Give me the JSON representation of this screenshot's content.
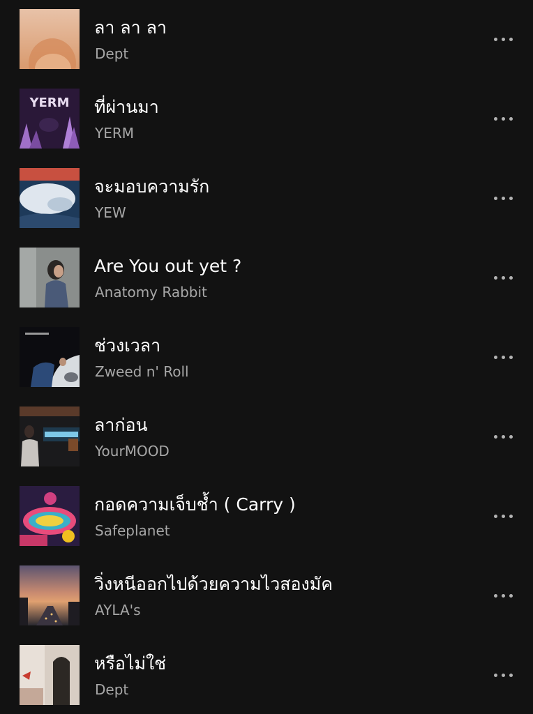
{
  "tracks": [
    {
      "title": "ลา ลา ลา",
      "artist": "Dept",
      "cover_icon": "album-cover"
    },
    {
      "title": "ที่ผ่านมา",
      "artist": "YERM",
      "cover_icon": "album-cover"
    },
    {
      "title": "จะมอบความรัก",
      "artist": "YEW",
      "cover_icon": "album-cover"
    },
    {
      "title": "Are You out yet ?",
      "artist": "Anatomy Rabbit",
      "cover_icon": "album-cover"
    },
    {
      "title": "ช่วงเวลา",
      "artist": "Zweed n' Roll",
      "cover_icon": "album-cover"
    },
    {
      "title": "ลาก่อน",
      "artist": "YourMOOD",
      "cover_icon": "album-cover"
    },
    {
      "title": "กอดความเจ็บช้ำ ( Carry )",
      "artist": "Safeplanet",
      "cover_icon": "album-cover"
    },
    {
      "title": "วิ่งหนีออกไปด้วยความไวสองมัค",
      "artist": "AYLA's",
      "cover_icon": "album-cover"
    },
    {
      "title": "หรือไม่ใช่",
      "artist": "Dept",
      "cover_icon": "album-cover"
    }
  ],
  "colors": {
    "background": "#121212",
    "title": "#ffffff",
    "artist": "#a7a7a7",
    "more_icon": "#b3b3b3"
  }
}
